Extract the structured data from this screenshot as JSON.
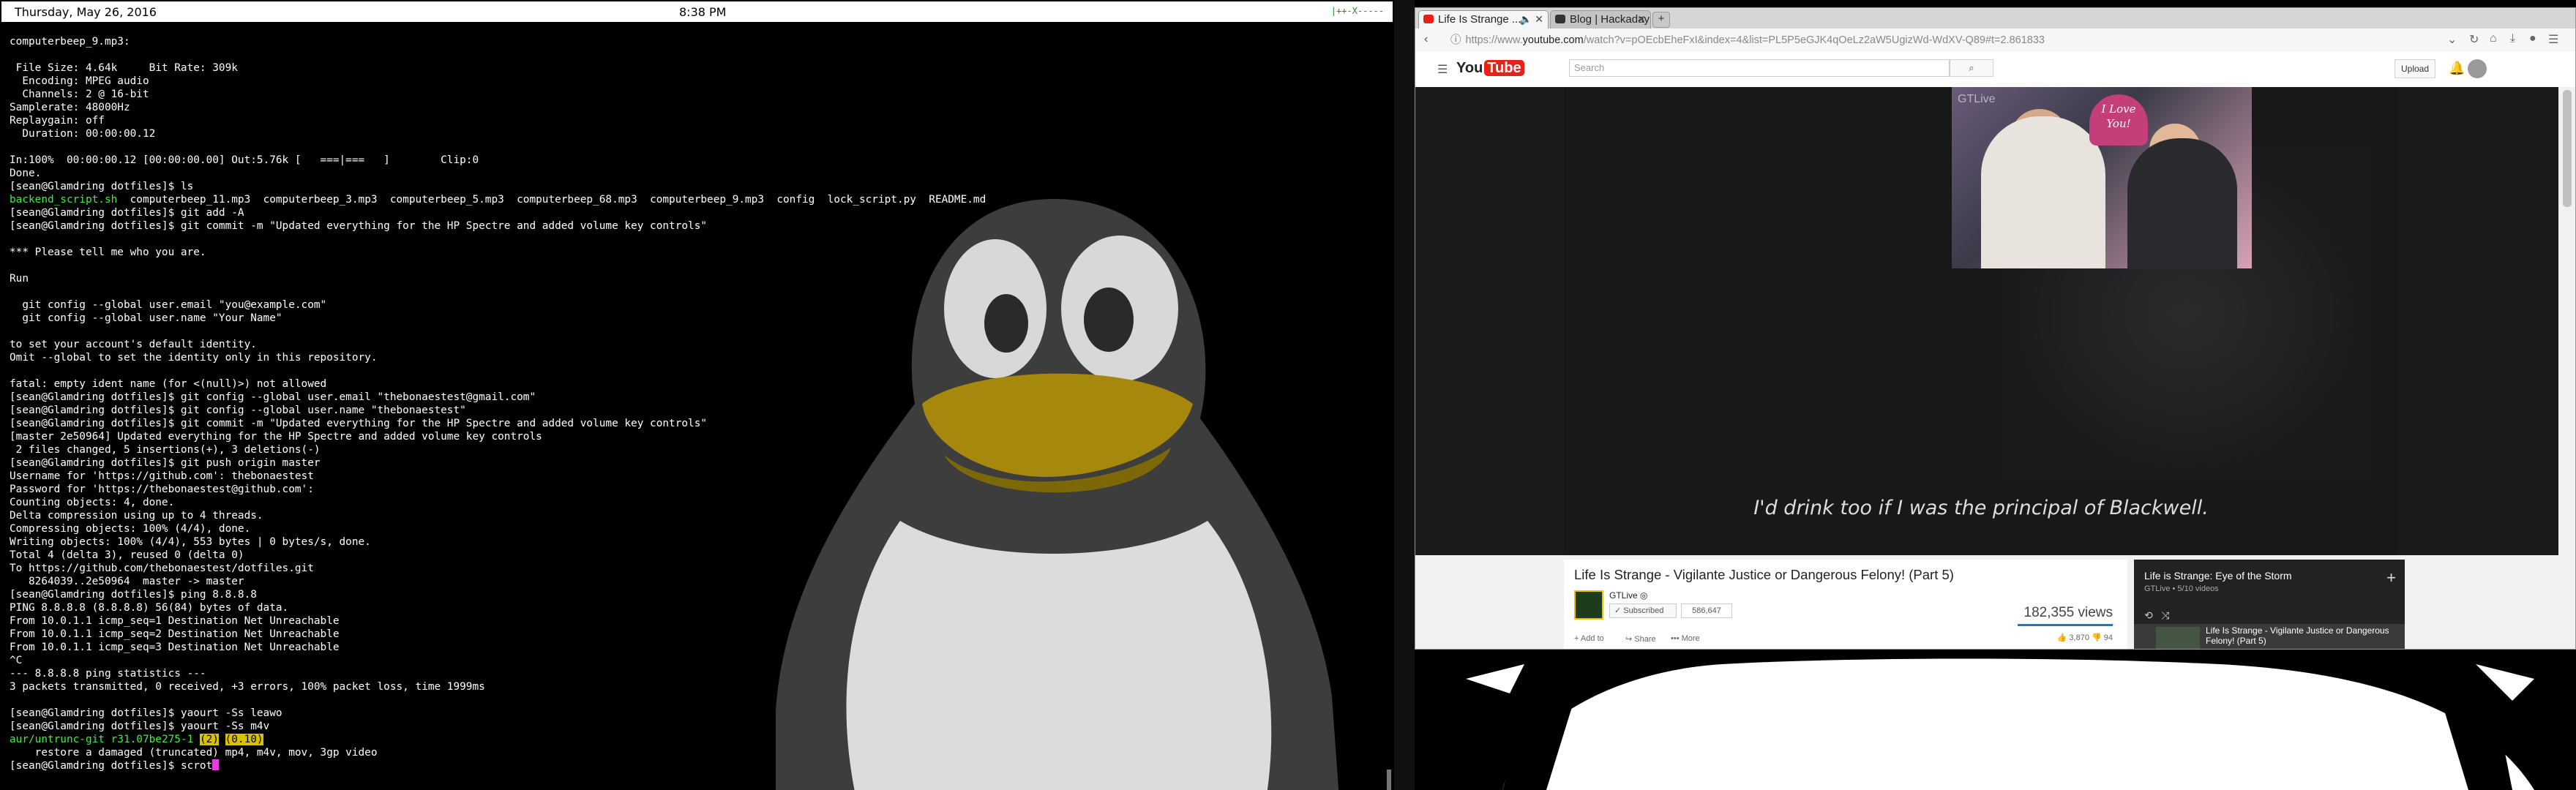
{
  "statusbar": {
    "date": "Thursday, May 26, 2016",
    "time": "8:38 PM",
    "tray": "|++-X-----"
  },
  "terminal": {
    "lines": [
      "computerbeep_9.mp3:",
      "",
      " File Size: 4.64k     Bit Rate: 309k",
      "  Encoding: MPEG audio",
      "  Channels: 2 @ 16-bit",
      "Samplerate: 48000Hz",
      "Replaygain: off",
      "  Duration: 00:00:00.12",
      "",
      "In:100%  00:00:00.12 [00:00:00.00] Out:5.76k [   ===|===   ]        Clip:0",
      "Done.",
      "[sean@Glamdring dotfiles]$ ls",
      "backend_script.sh  computerbeep_11.mp3  computerbeep_3.mp3  computerbeep_5.mp3  computerbeep_68.mp3  computerbeep_9.mp3  config  lock_script.py  README.md",
      "[sean@Glamdring dotfiles]$ git add -A",
      "[sean@Glamdring dotfiles]$ git commit -m \"Updated everything for the HP Spectre and added volume key controls\"",
      "",
      "*** Please tell me who you are.",
      "",
      "Run",
      "",
      "  git config --global user.email \"you@example.com\"",
      "  git config --global user.name \"Your Name\"",
      "",
      "to set your account's default identity.",
      "Omit --global to set the identity only in this repository.",
      "",
      "fatal: empty ident name (for <(null)>) not allowed",
      "[sean@Glamdring dotfiles]$ git config --global user.email \"thebonaestest@gmail.com\"",
      "[sean@Glamdring dotfiles]$ git config --global user.name \"thebonaestest\"",
      "[sean@Glamdring dotfiles]$ git commit -m \"Updated everything for the HP Spectre and added volume key controls\"",
      "[master 2e50964] Updated everything for the HP Spectre and added volume key controls",
      " 2 files changed, 5 insertions(+), 3 deletions(-)",
      "[sean@Glamdring dotfiles]$ git push origin master",
      "Username for 'https://github.com': thebonaestest",
      "Password for 'https://thebonaestest@github.com':",
      "Counting objects: 4, done.",
      "Delta compression using up to 4 threads.",
      "Compressing objects: 100% (4/4), done.",
      "Writing objects: 100% (4/4), 553 bytes | 0 bytes/s, done.",
      "Total 4 (delta 3), reused 0 (delta 0)",
      "To https://github.com/thebonaestest/dotfiles.git",
      "   8264039..2e50964  master -> master",
      "[sean@Glamdring dotfiles]$ ping 8.8.8.8",
      "PING 8.8.8.8 (8.8.8.8) 56(84) bytes of data.",
      "From 10.0.1.1 icmp_seq=1 Destination Net Unreachable",
      "From 10.0.1.1 icmp_seq=2 Destination Net Unreachable",
      "From 10.0.1.1 icmp_seq=3 Destination Net Unreachable",
      "^C",
      "--- 8.8.8.8 ping statistics ---",
      "3 packets transmitted, 0 received, +3 errors, 100% packet loss, time 1999ms",
      "",
      "[sean@Glamdring dotfiles]$ yaourt -Ss leawo",
      "[sean@Glamdring dotfiles]$ yaourt -Ss m4v"
    ],
    "ls_files": "backend_script.sh",
    "ls_rest": "  computerbeep_11.mp3  computerbeep_3.mp3  computerbeep_5.mp3  computerbeep_68.mp3  computerbeep_9.mp3  config  lock_script.py  README.md",
    "pkg_name": "aur/untrunc-git",
    "pkg_version": "r31.07be275-1",
    "pkg_votes": "(2)",
    "pkg_pop": "(0.10)",
    "pkg_desc": "    restore a damaged (truncated) mp4, m4v, mov, 3gp video",
    "prompt": "[sean@Glamdring dotfiles]$ ",
    "input": "scrot"
  },
  "browser": {
    "tabs": [
      {
        "label": "Life Is Strange ...",
        "active": true,
        "fav_color": "#e62117"
      },
      {
        "label": "Blog | Hackaday |...",
        "active": false,
        "fav_color": "#333333"
      }
    ],
    "new_tab": "+",
    "url_lock": "ⓘ",
    "url_prefix": "https://www.",
    "url_host": "youtube.com",
    "url_path": "/watch?v=pOEcbEheFxI&index=4&list=PL5P5eGJK4qOeLz2aW5UgizWd-WdXV-Q89#t=2.861833"
  },
  "youtube": {
    "logo_you": "You",
    "logo_tube": "Tube",
    "search_placeholder": "Search",
    "upload": "Upload",
    "caption": "I'd drink too if I was the principal of Blackwell.",
    "pip_sign": "I Love You!",
    "pip_logo": "GTLive",
    "title": "Life Is Strange - Vigilante Justice or Dangerous Felony! (Part 5)",
    "channel": "GTLive ◎",
    "subscribed": "✓ Subscribed",
    "sub_count": "586,647",
    "views": "182,355 views",
    "add_to": "+ Add to",
    "share": "↪ Share",
    "more": "••• More",
    "likes": "👍 3,870   👎 94",
    "playlist": {
      "title": "Life is Strange: Eye of the Storm",
      "subtitle": "GTLive • 5/10 videos",
      "current": "Life Is Strange - Vigilante Justice or Dangerous Felony! (Part 5)"
    }
  }
}
